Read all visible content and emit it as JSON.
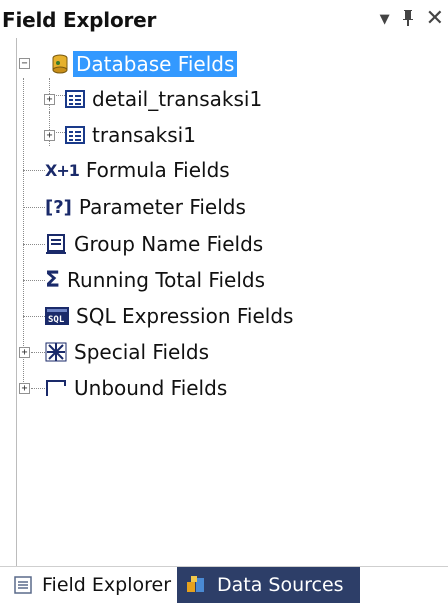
{
  "window": {
    "title": "Field Explorer",
    "buttons": {
      "dropdown": "▼",
      "pin": "ᵖ",
      "close": "✕"
    }
  },
  "tree": {
    "database_fields": "Database Fields",
    "detail_transaksi": "detail_transaksi1",
    "transaksi": "transaksi1",
    "formula_fields": "Formula Fields",
    "parameter_fields": "Parameter Fields",
    "group_name_fields": "Group Name Fields",
    "running_total_fields": "Running Total Fields",
    "sql_expression_fields": "SQL Expression Fields",
    "special_fields": "Special Fields",
    "unbound_fields": "Unbound Fields"
  },
  "tabs": {
    "field_explorer": "Field Explorer",
    "data_sources": "Data Sources"
  },
  "colors": {
    "selection": "#3399ff",
    "inactive_tab": "#2d3e68"
  }
}
